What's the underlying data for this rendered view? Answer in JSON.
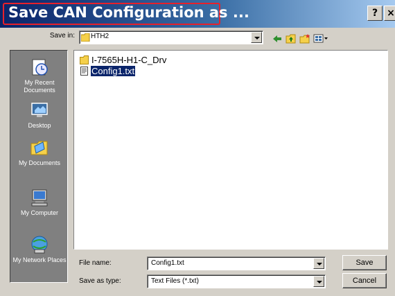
{
  "dialog": {
    "title": "Save CAN Configuration  as ...",
    "help_label": "?",
    "close_label": "×"
  },
  "toolbar": {
    "save_in_label": "Save in:",
    "save_in_value": "HTH2",
    "icons": [
      "back-icon",
      "up-folder-icon",
      "new-folder-icon",
      "view-menu-icon"
    ]
  },
  "places": [
    {
      "label": "My Recent Documents",
      "icon": "recent-documents-icon"
    },
    {
      "label": "Desktop",
      "icon": "desktop-icon"
    },
    {
      "label": "My Documents",
      "icon": "my-documents-icon"
    },
    {
      "label": "My Computer",
      "icon": "my-computer-icon"
    },
    {
      "label": "My Network Places",
      "icon": "network-places-icon"
    }
  ],
  "files": [
    {
      "name": "I-7565H-H1-C_Drv",
      "type": "folder",
      "selected": false
    },
    {
      "name": "Config1.txt",
      "type": "text",
      "selected": true
    }
  ],
  "form": {
    "filename_label": "File name:",
    "filename_value": "Config1.txt",
    "filetype_label": "Save as type:",
    "filetype_value": "Text Files (*.txt)",
    "save_label": "Save",
    "cancel_label": "Cancel"
  },
  "colors": {
    "title_start": "#0a246a",
    "title_end": "#a6caf0",
    "highlight": "#e8202a",
    "selection": "#0a246a",
    "dialog_bg": "#d4d0c8"
  }
}
